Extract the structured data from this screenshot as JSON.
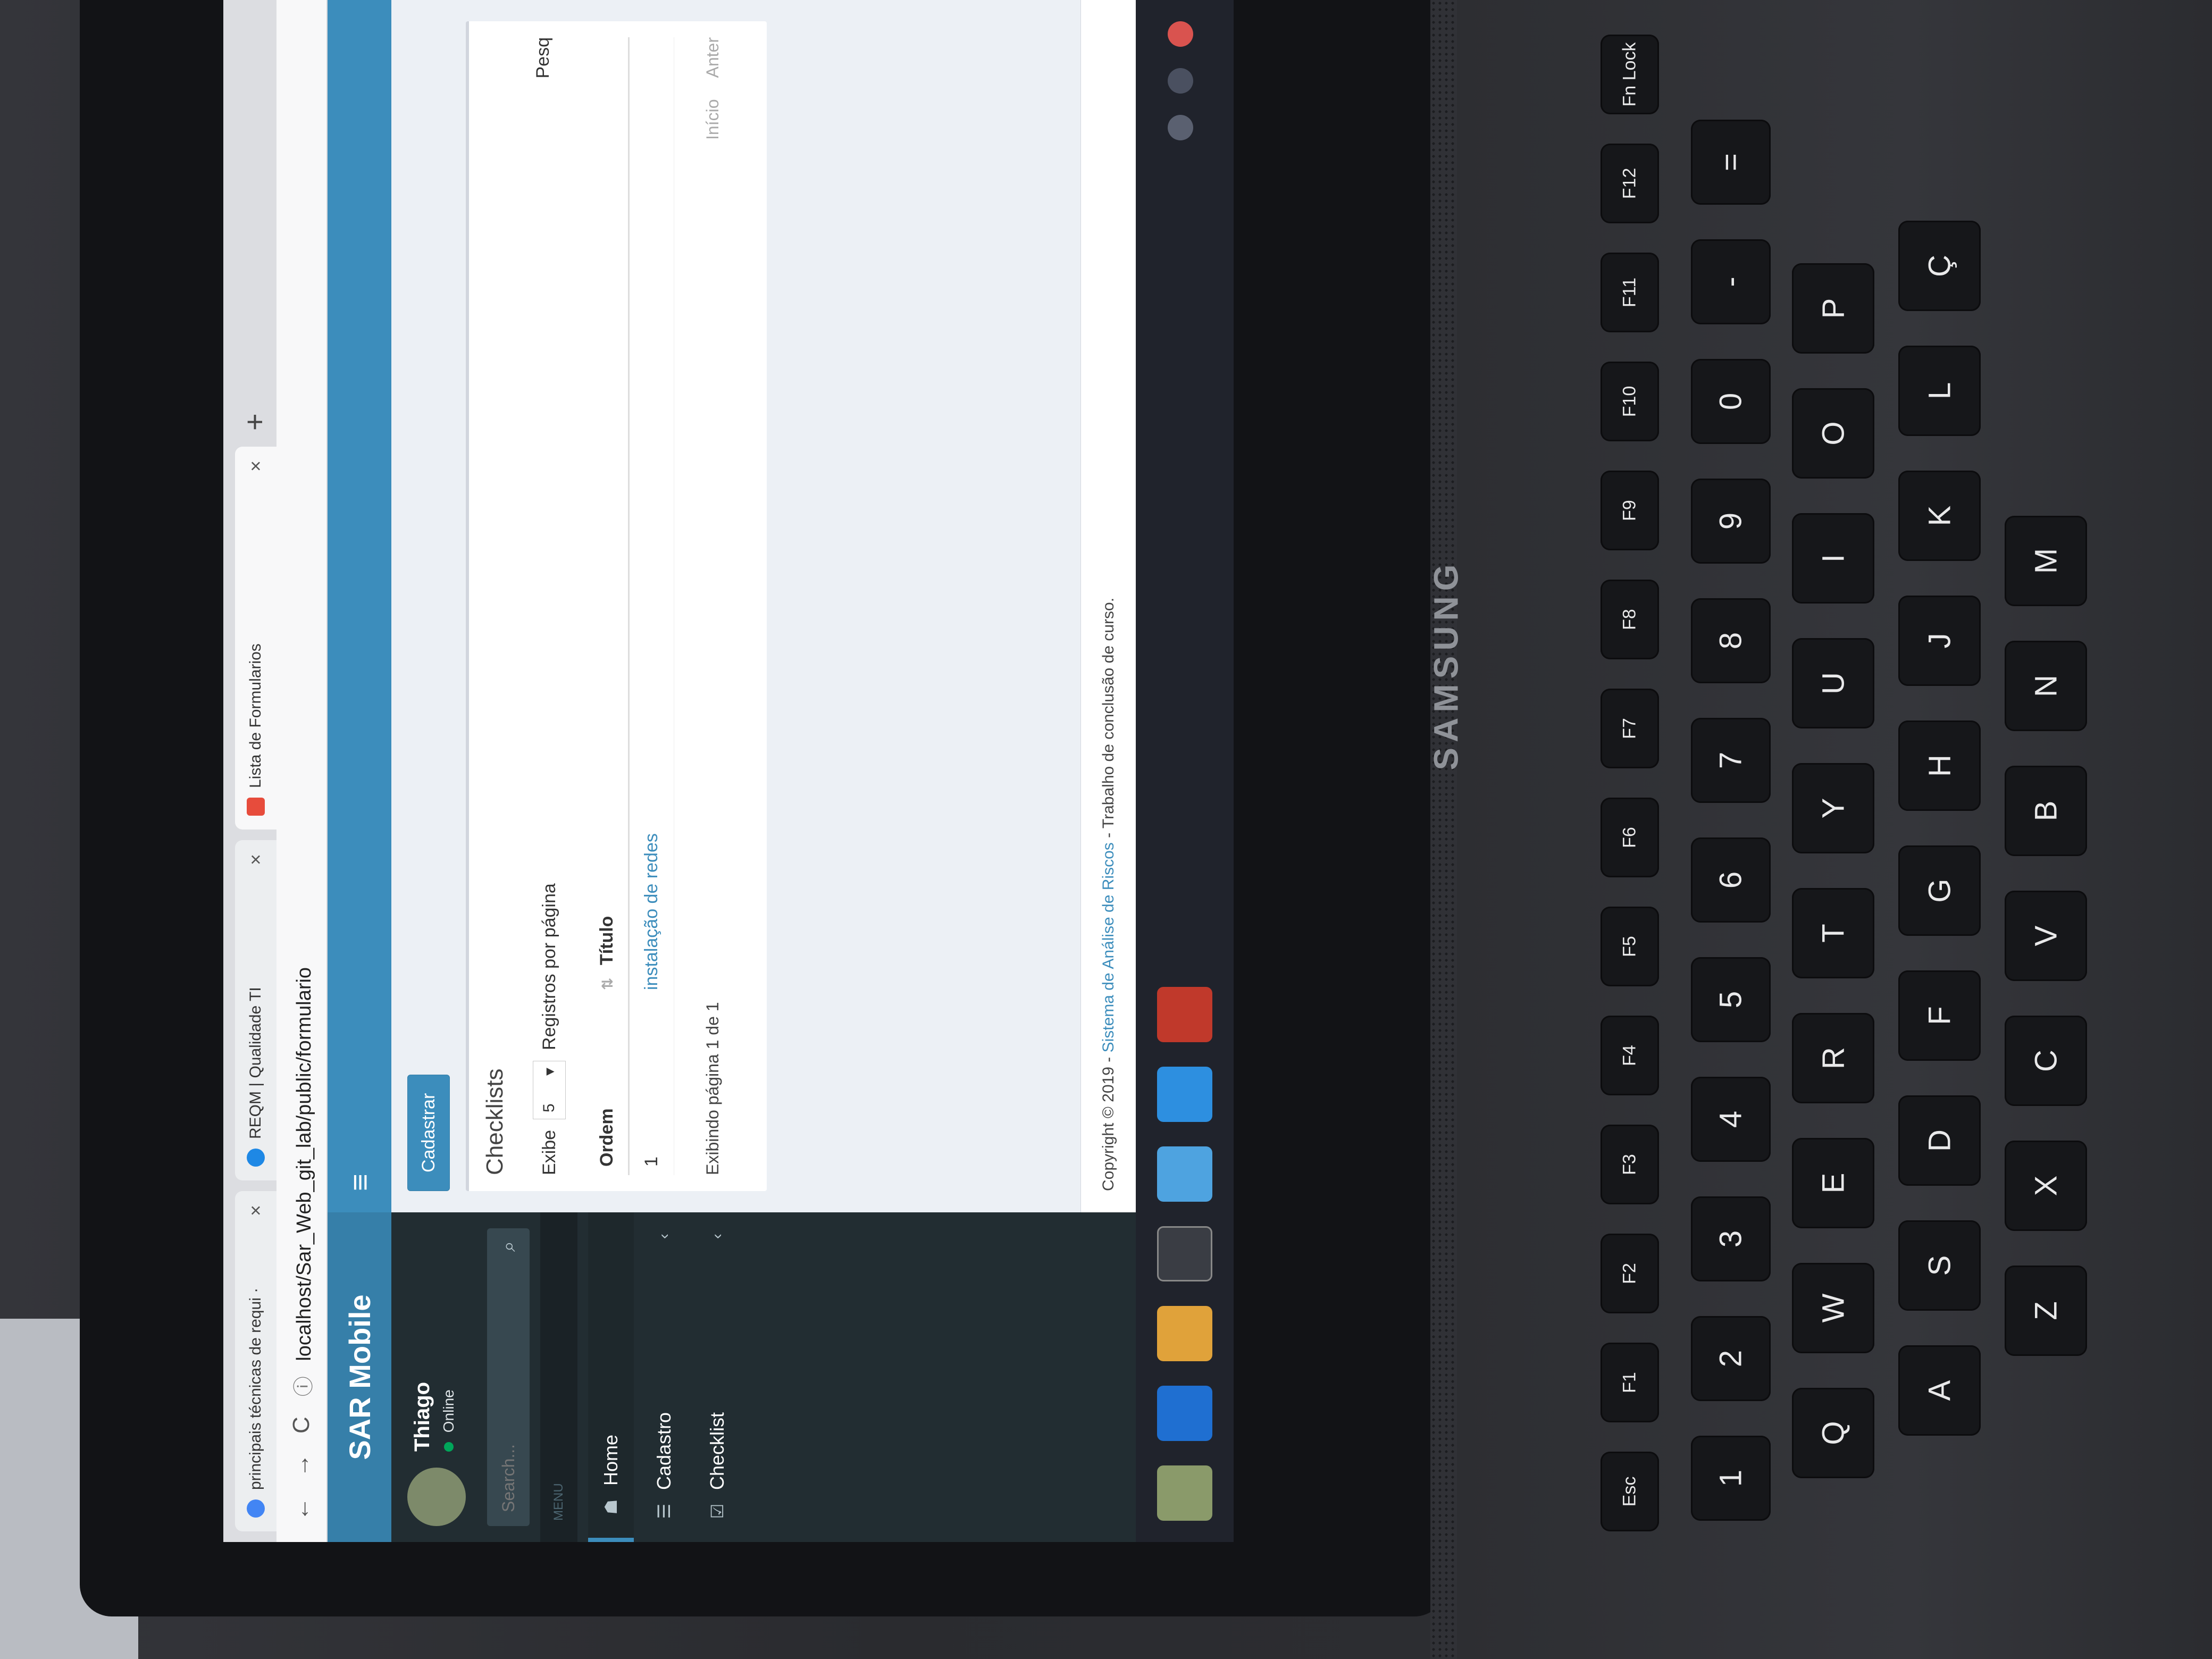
{
  "browser": {
    "tabs": [
      {
        "title": "principais técnicas de requi ·",
        "favicon_color": "#4285f4"
      },
      {
        "title": "REQM | Qualidade TI",
        "favicon_color": "#1e88e5"
      },
      {
        "title": "Lista de Formularios",
        "favicon_color": "#e74c3c"
      }
    ],
    "new_tab": "+",
    "close": "×",
    "url": "localhost/Sar_Web_git_lab/public/formulario",
    "url_info": "ⓘ",
    "nav": {
      "back": "←",
      "forward": "→",
      "reload": "C"
    }
  },
  "sidebar": {
    "logo": "SAR Mobile",
    "user_name": "Thiago",
    "user_status": "Online",
    "search_placeholder": "Search...",
    "search_icon": "magnifier-icon",
    "menu_header": "MENU",
    "items": [
      {
        "label": "Home",
        "icon": "home-icon",
        "glyph": "☗"
      },
      {
        "label": "Cadastro",
        "icon": "list-icon",
        "glyph": "☰"
      },
      {
        "label": "Checklist",
        "icon": "checkbox-icon",
        "glyph": "☑"
      }
    ],
    "chevron": "‹"
  },
  "topnav": {
    "toggle": "≡"
  },
  "content": {
    "cadastrar_label": "Cadastrar",
    "box_title": "Checklists",
    "length_prefix": "Exibe",
    "length_value": "5",
    "length_suffix": "Registros por página",
    "filter_label": "Pesq",
    "table": {
      "headers": [
        "Ordem",
        "Título"
      ],
      "rows": [
        {
          "ordem": "1",
          "titulo": "instalação de redes"
        }
      ]
    },
    "info": "Exibindo página 1 de 1",
    "pager": {
      "first": "Início",
      "prev": "Anter"
    }
  },
  "footer": {
    "copyright": "Copyright © 2019 -",
    "name": "Sistema de Análise de Riscos",
    "suffix": "- Trabalho de conclusão de curso."
  },
  "laptop": {
    "brand": "SAMSUNG",
    "keys": [
      {
        "label": "Esc",
        "fn": true
      },
      {
        "label": "F1",
        "fn": true
      },
      {
        "label": "F2",
        "fn": true
      },
      {
        "label": "F3",
        "fn": true
      },
      {
        "label": "F4",
        "fn": true
      },
      {
        "label": "F5",
        "fn": true
      },
      {
        "label": "F6",
        "fn": true
      },
      {
        "label": "F7",
        "fn": true
      },
      {
        "label": "F8",
        "fn": true
      },
      {
        "label": "F9",
        "fn": true
      },
      {
        "label": "F10",
        "fn": true
      },
      {
        "label": "F11",
        "fn": true
      },
      {
        "label": "F12",
        "fn": true
      },
      {
        "label": "Fn Lock",
        "fn": true
      },
      {
        "label": "1"
      },
      {
        "label": "2"
      },
      {
        "label": "3"
      },
      {
        "label": "4"
      },
      {
        "label": "5"
      },
      {
        "label": "6"
      },
      {
        "label": "7"
      },
      {
        "label": "8"
      },
      {
        "label": "9"
      },
      {
        "label": "0"
      },
      {
        "label": "-"
      },
      {
        "label": "="
      },
      {
        "label": "Q"
      },
      {
        "label": "W"
      },
      {
        "label": "E"
      },
      {
        "label": "R"
      },
      {
        "label": "T"
      },
      {
        "label": "Y"
      },
      {
        "label": "U"
      },
      {
        "label": "I"
      },
      {
        "label": "O"
      },
      {
        "label": "P"
      },
      {
        "label": "A"
      },
      {
        "label": "S"
      },
      {
        "label": "D"
      },
      {
        "label": "F"
      },
      {
        "label": "G"
      },
      {
        "label": "H"
      },
      {
        "label": "J"
      },
      {
        "label": "K"
      },
      {
        "label": "L"
      },
      {
        "label": "Ç"
      },
      {
        "label": "Z"
      },
      {
        "label": "X"
      },
      {
        "label": "C"
      },
      {
        "label": "V"
      },
      {
        "label": "B"
      },
      {
        "label": "N"
      },
      {
        "label": "M"
      }
    ]
  }
}
